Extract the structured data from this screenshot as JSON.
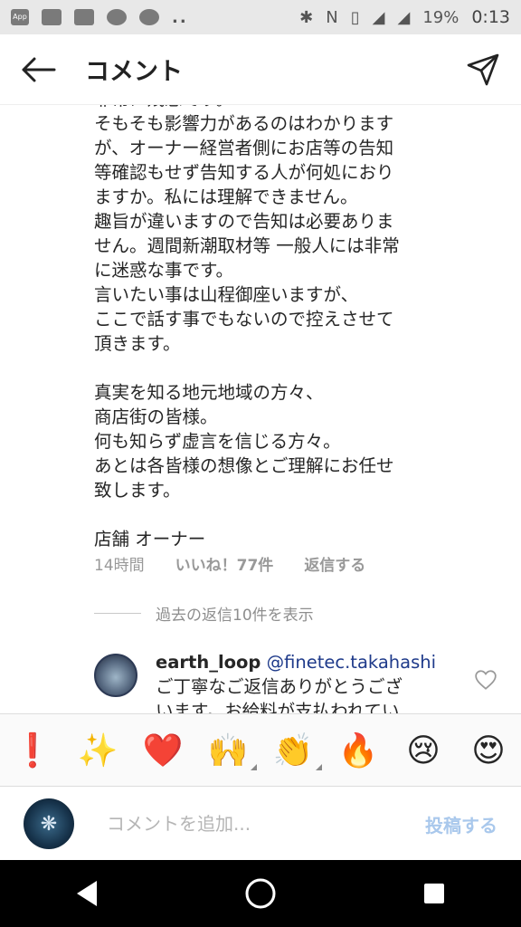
{
  "status_bar": {
    "left_icons": [
      "app-icon",
      "sim-icon",
      "image-icon",
      "chat-icon",
      "parking-icon",
      "more-dots-icon"
    ],
    "app_label": "App",
    "dots": "..",
    "battery": "19%",
    "time": "0:13"
  },
  "header": {
    "title": "コメント"
  },
  "comment": {
    "body": "非常に残念です。\nそもそも影響力があるのはわかります\nが、オーナー経営者側にお店等の告知\n等確認もせず告知する人が何処におり\nますか。私には理解できません。\n趣旨が違いますので告知は必要ありま\nせん。週間新潮取材等 一般人には非常\nに迷惑な事です。\n言いたい事は山程御座いますが、\nここで話す事でもないので控えさせて\n頂きます。\n\n真実を知る地元地域の方々、\n商店街の皆様。\n何も知らず虚言を信じる方々。\nあとは各皆様の想像とご理解にお任せ\n致します。\n\n店舗 オーナー",
    "time": "14時間",
    "likes": "いいね！77件",
    "reply_label": "返信する"
  },
  "view_replies": {
    "label": "過去の返信10件を表示"
  },
  "reply": {
    "username": "earth_loop",
    "mention": "@finetec.takahashi",
    "text": "ご丁寧なご返信ありがとうござ\nいます。お給料が支払われてい"
  },
  "emoji_bar": {
    "items": [
      "❗",
      "✨",
      "❤️",
      "🙌",
      "👏",
      "🔥",
      "😢",
      "😍"
    ]
  },
  "input": {
    "placeholder": "コメントを追加...",
    "post_label": "投稿する"
  },
  "colors": {
    "accent": "#3897f0",
    "post_disabled": "#a9c8ec",
    "text": "#262626",
    "muted": "#999999"
  }
}
